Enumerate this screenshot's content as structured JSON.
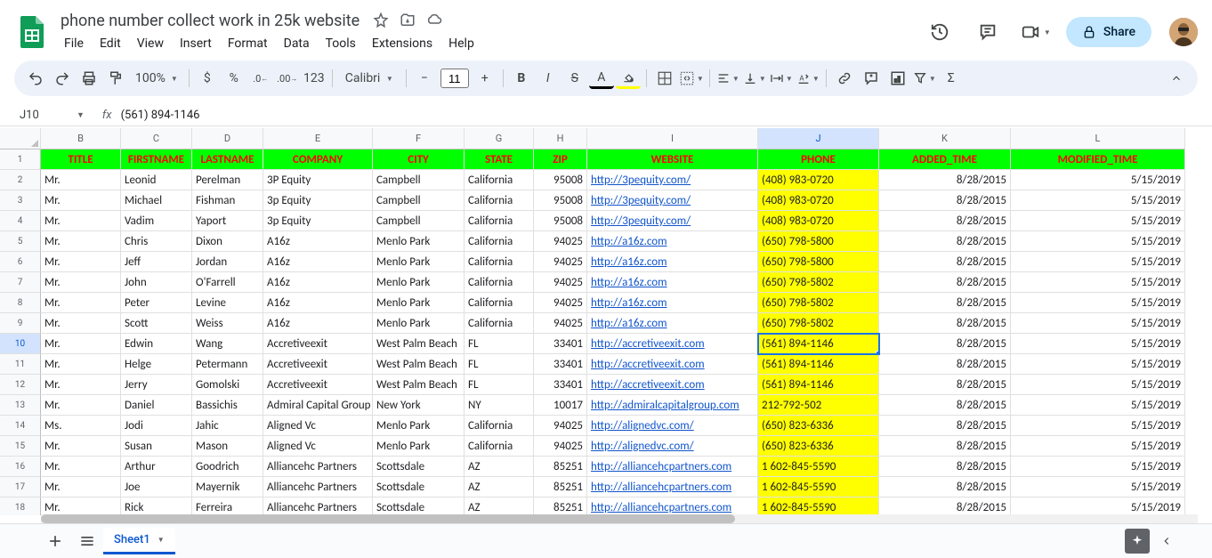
{
  "doc": {
    "title": "phone number collect work in 25k website"
  },
  "menus": [
    "File",
    "Edit",
    "View",
    "Insert",
    "Format",
    "Data",
    "Tools",
    "Extensions",
    "Help"
  ],
  "share_label": "Share",
  "toolbar": {
    "zoom": "100%",
    "font": "Calibri",
    "font_size": "11",
    "num_fmt": "123"
  },
  "name_box": "J10",
  "formula": "(561) 894-1146",
  "columns": [
    {
      "letter": "B",
      "key": "title",
      "width": "c-B",
      "align": ""
    },
    {
      "letter": "C",
      "key": "firstname",
      "width": "c-C",
      "align": ""
    },
    {
      "letter": "D",
      "key": "lastname",
      "width": "c-D",
      "align": ""
    },
    {
      "letter": "E",
      "key": "company",
      "width": "c-E",
      "align": ""
    },
    {
      "letter": "F",
      "key": "city",
      "width": "c-F",
      "align": ""
    },
    {
      "letter": "G",
      "key": "state",
      "width": "c-G",
      "align": ""
    },
    {
      "letter": "H",
      "key": "zip",
      "width": "c-H",
      "align": "rt"
    },
    {
      "letter": "I",
      "key": "website",
      "width": "c-I",
      "align": "",
      "link": true
    },
    {
      "letter": "J",
      "key": "phone",
      "width": "c-J",
      "align": "",
      "phone": true
    },
    {
      "letter": "K",
      "key": "added",
      "width": "c-K",
      "align": "rt"
    },
    {
      "letter": "L",
      "key": "modified",
      "width": "c-L",
      "align": "rt"
    }
  ],
  "headers": {
    "title": "TITLE",
    "firstname": "FIRSTNAME",
    "lastname": "LASTNAME",
    "company": "COMPANY",
    "city": "CITY",
    "state": "STATE",
    "zip": "ZIP",
    "website": "WEBSITE",
    "phone": "PHONE",
    "added": "ADDED_TIME",
    "modified": "MODIFIED_TIME"
  },
  "rows": [
    {
      "title": "Mr.",
      "firstname": "Leonid",
      "lastname": "Perelman",
      "company": "3P Equity",
      "city": "Campbell",
      "state": "California",
      "zip": "95008",
      "website": "http://3pequity.com/",
      "phone": "(408) 983-0720",
      "added": "8/28/2015",
      "modified": "5/15/2019"
    },
    {
      "title": "Mr.",
      "firstname": "Michael",
      "lastname": "Fishman",
      "company": "3p Equity",
      "city": "Campbell",
      "state": "California",
      "zip": "95008",
      "website": "http://3pequity.com/",
      "phone": "(408) 983-0720",
      "added": "8/28/2015",
      "modified": "5/15/2019"
    },
    {
      "title": "Mr.",
      "firstname": "Vadim",
      "lastname": "Yaport",
      "company": "3p Equity",
      "city": "Campbell",
      "state": "California",
      "zip": "95008",
      "website": "http://3pequity.com/",
      "phone": "(408) 983-0720",
      "added": "8/28/2015",
      "modified": "5/15/2019"
    },
    {
      "title": "Mr.",
      "firstname": "Chris",
      "lastname": "Dixon",
      "company": "A16z",
      "city": "Menlo Park",
      "state": "California",
      "zip": "94025",
      "website": "http://a16z.com",
      "phone": "(650) 798-5800",
      "added": "8/28/2015",
      "modified": "5/15/2019"
    },
    {
      "title": "Mr.",
      "firstname": "Jeff",
      "lastname": "Jordan",
      "company": "A16z",
      "city": "Menlo Park",
      "state": "California",
      "zip": "94025",
      "website": "http://a16z.com",
      "phone": "(650) 798-5800",
      "added": "8/28/2015",
      "modified": "5/15/2019"
    },
    {
      "title": "Mr.",
      "firstname": "John",
      "lastname": "O'Farrell",
      "company": "A16z",
      "city": "Menlo Park",
      "state": "California",
      "zip": "94025",
      "website": "http://a16z.com",
      "phone": "(650) 798-5802",
      "added": "8/28/2015",
      "modified": "5/15/2019"
    },
    {
      "title": "Mr.",
      "firstname": "Peter",
      "lastname": "Levine",
      "company": "A16z",
      "city": "Menlo Park",
      "state": "California",
      "zip": "94025",
      "website": "http://a16z.com",
      "phone": "(650) 798-5802",
      "added": "8/28/2015",
      "modified": "5/15/2019"
    },
    {
      "title": "Mr.",
      "firstname": "Scott",
      "lastname": "Weiss",
      "company": "A16z",
      "city": "Menlo Park",
      "state": "California",
      "zip": "94025",
      "website": "http://a16z.com",
      "phone": "(650) 798-5802",
      "added": "8/28/2015",
      "modified": "5/15/2019"
    },
    {
      "title": "Mr.",
      "firstname": "Edwin",
      "lastname": "Wang",
      "company": "Accretiveexit",
      "city": "West Palm Beach",
      "state": "FL",
      "zip": "33401",
      "website": "http://accretiveexit.com",
      "phone": "(561) 894-1146",
      "added": "8/28/2015",
      "modified": "5/15/2019"
    },
    {
      "title": "Mr.",
      "firstname": "Helge",
      "lastname": "Petermann",
      "company": "Accretiveexit",
      "city": "West Palm Beach",
      "state": "FL",
      "zip": "33401",
      "website": "http://accretiveexit.com",
      "phone": "(561) 894-1146",
      "added": "8/28/2015",
      "modified": "5/15/2019"
    },
    {
      "title": "Mr.",
      "firstname": "Jerry",
      "lastname": "Gomolski",
      "company": "Accretiveexit",
      "city": "West Palm Beach",
      "state": "FL",
      "zip": "33401",
      "website": "http://accretiveexit.com",
      "phone": "(561) 894-1146",
      "added": "8/28/2015",
      "modified": "5/15/2019"
    },
    {
      "title": "Mr.",
      "firstname": "Daniel",
      "lastname": "Bassichis",
      "company": "Admiral Capital Group",
      "city": "New York",
      "state": "NY",
      "zip": "10017",
      "website": "http://admiralcapitalgroup.com",
      "phone": "212-792-502",
      "added": "8/28/2015",
      "modified": "5/15/2019"
    },
    {
      "title": "Ms.",
      "firstname": "Jodi",
      "lastname": "Jahic",
      "company": "Aligned Vc",
      "city": "Menlo Park",
      "state": "California",
      "zip": "94025",
      "website": "http://alignedvc.com/",
      "phone": "(650) 823-6336",
      "added": "8/28/2015",
      "modified": "5/15/2019"
    },
    {
      "title": "Mr.",
      "firstname": "Susan",
      "lastname": "Mason",
      "company": "Aligned Vc",
      "city": "Menlo Park",
      "state": "California",
      "zip": "94025",
      "website": "http://alignedvc.com/",
      "phone": "(650) 823-6336",
      "added": "8/28/2015",
      "modified": "5/15/2019"
    },
    {
      "title": "Mr.",
      "firstname": "Arthur",
      "lastname": "Goodrich",
      "company": "Alliancehc Partners",
      "city": "Scottsdale",
      "state": "AZ",
      "zip": "85251",
      "website": "http://alliancehcpartners.com",
      "phone": "1 602-845-5590",
      "added": "8/28/2015",
      "modified": "5/15/2019"
    },
    {
      "title": "Mr.",
      "firstname": "Joe",
      "lastname": "Mayernik",
      "company": "Alliancehc Partners",
      "city": "Scottsdale",
      "state": "AZ",
      "zip": "85251",
      "website": "http://alliancehcpartners.com",
      "phone": "1 602-845-5590",
      "added": "8/28/2015",
      "modified": "5/15/2019"
    },
    {
      "title": "Mr.",
      "firstname": "Rick",
      "lastname": "Ferreira",
      "company": "Alliancehc Partners",
      "city": "Scottsdale",
      "state": "AZ",
      "zip": "85251",
      "website": "http://alliancehcpartners.com",
      "phone": "1 602-845-5590",
      "added": "8/28/2015",
      "modified": "5/15/2019"
    }
  ],
  "active": {
    "row_index": 8,
    "col_index": 8
  },
  "sheet_tab": "Sheet1"
}
